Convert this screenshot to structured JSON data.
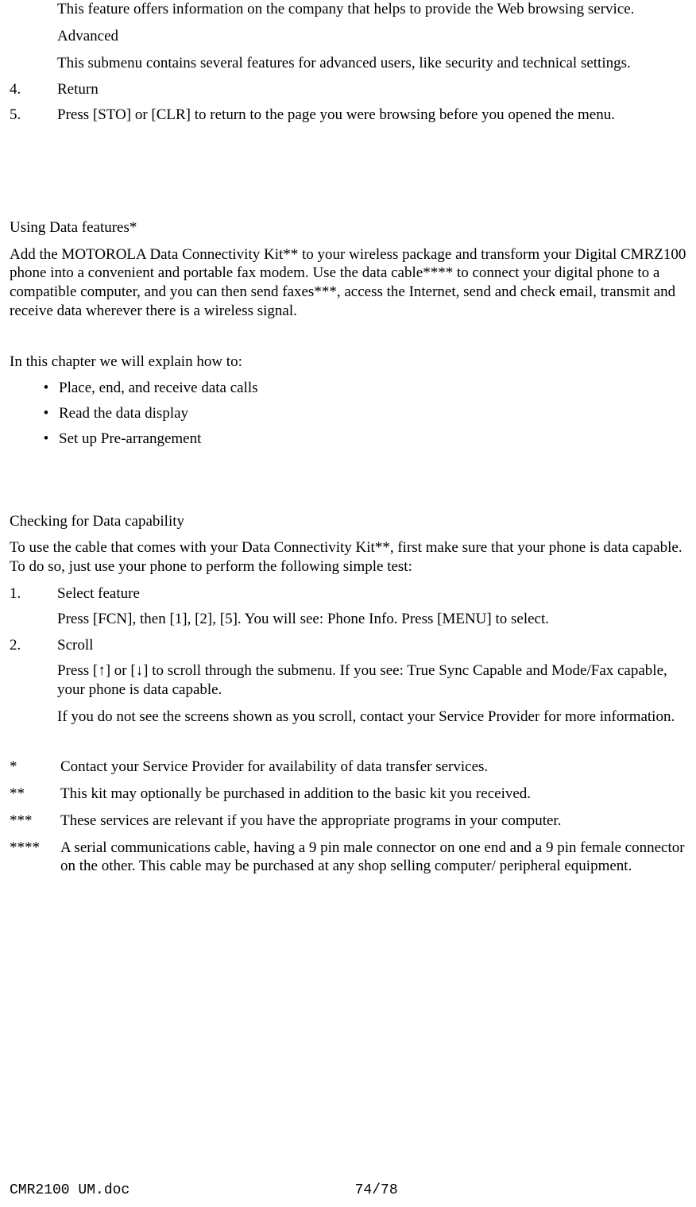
{
  "top": {
    "about_desc": "This feature offers information on the company that helps to provide the Web browsing service.",
    "advanced_title": "Advanced",
    "advanced_desc": "This submenu contains several features for advanced users, like security and technical settings.",
    "items": [
      {
        "num": "4.",
        "title": "Return",
        "body": ""
      },
      {
        "num": "5.",
        "title": "Press [STO] or [CLR] to return to the page you were browsing before you opened the menu.",
        "body": ""
      }
    ]
  },
  "data_features": {
    "title": "Using Data features*",
    "intro": "Add the MOTOROLA Data Connectivity Kit** to your wireless package and transform your Digital CMRZ100 phone into a convenient and portable fax modem. Use the data cable**** to connect your digital phone to a compatible computer, and you can then send faxes***, access the Internet, send and check email, transmit and receive data wherever there is a wireless signal.",
    "chapter_lead": "In this chapter we will explain how to:",
    "bullets": [
      "Place, end, and receive data calls",
      "Read the data display",
      "Set up Pre-arrangement"
    ]
  },
  "check": {
    "title": "Checking for Data capability",
    "intro": "To use the cable that comes with your Data Connectivity Kit**, first make sure that your phone is data capable. To do so, just use your phone to perform the following simple test:",
    "steps": [
      {
        "num": "1.",
        "title": "Select feature",
        "body": "Press [FCN], then [1], [2], [5]. You will see: Phone Info. Press [MENU] to select."
      },
      {
        "num": "2.",
        "title": "Scroll",
        "body": "Press [↑] or [↓] to scroll through the submenu. If you see: True Sync Capable and Mode/Fax capable, your phone is data capable.",
        "extra": "If you do not see the screens shown as you scroll, contact your Service  Provider for more information."
      }
    ]
  },
  "footnotes": [
    {
      "mark": "*",
      "text": "Contact your Service Provider for availability of data transfer services."
    },
    {
      "mark": "**",
      "text": "This kit may optionally be purchased in addition to the basic kit you received."
    },
    {
      "mark": "***",
      "text": "These services are relevant if you have the appropriate programs in your computer."
    },
    {
      "mark": "****",
      "text": "A serial communications cable, having a 9 pin male connector on one end and a 9 pin female connector on the other. This cable may be purchased at any shop selling computer/ peripheral equipment."
    }
  ],
  "footer": {
    "doc": "CMR2100 UM.doc",
    "page": "74/78"
  }
}
